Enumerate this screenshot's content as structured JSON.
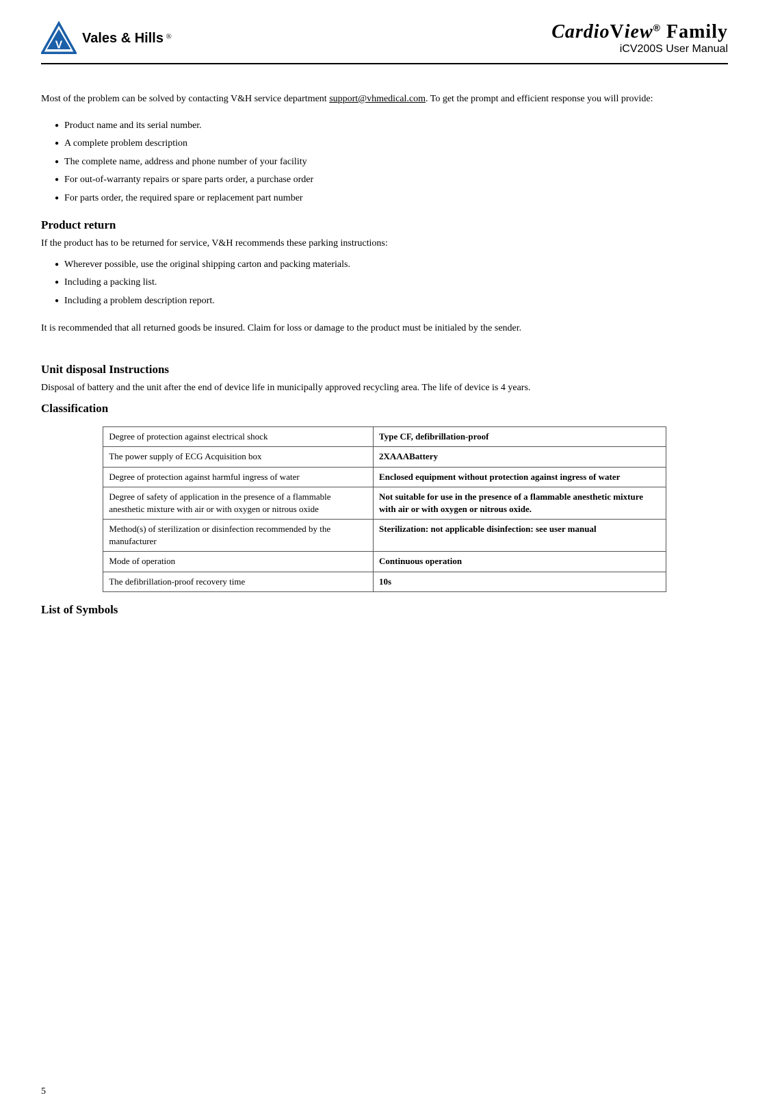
{
  "header": {
    "logo_company": "Vales & Hills",
    "logo_reg": "®",
    "product_name": "CardioView",
    "product_reg": "®",
    "product_family": "Family",
    "product_model": "iCV200S User Manual"
  },
  "intro": {
    "text1": "Most of the problem can be solved by contacting V&H service department ",
    "email": "support@vhmedical.com",
    "text2": ". To get the prompt and efficient response you will provide:"
  },
  "bullet_list_1": [
    "Product name and its serial number.",
    "A complete problem description",
    "The complete name, address and phone number of your facility",
    "For out-of-warranty repairs or spare parts order, a purchase order",
    "For parts order, the required spare or replacement part number"
  ],
  "product_return": {
    "heading": "Product return",
    "text": "If the product has to be returned for service, V&H recommends these parking instructions:"
  },
  "bullet_list_2": [
    "Wherever possible, use the original shipping carton and packing materials.",
    "Including a packing list.",
    "Including a problem description report."
  ],
  "product_return_footer": "It is recommended that all returned goods be insured. Claim for loss or damage to the product must be initialed by the sender.",
  "unit_disposal": {
    "heading": "Unit disposal Instructions",
    "text": "Disposal of battery and the unit after the end of device life in municipally approved recycling area. The life of device is 4 years."
  },
  "classification": {
    "heading": "Classification",
    "table_rows": [
      {
        "col1": "Degree of protection against electrical shock",
        "col2": "Type CF, defibrillation-proof"
      },
      {
        "col1": "The power supply of ECG Acquisition box",
        "col2": "2XAAABattery"
      },
      {
        "col1": "Degree of protection against harmful ingress of water",
        "col2": "Enclosed equipment without protection against ingress of water"
      },
      {
        "col1": "Degree of safety of application in the presence of a flammable anesthetic mixture with air or with oxygen or nitrous oxide",
        "col2": "Not suitable for use in the presence of a flammable anesthetic mixture with air or with oxygen or nitrous oxide."
      },
      {
        "col1": "Method(s) of sterilization or disinfection recommended by the manufacturer",
        "col2": "Sterilization: not applicable disinfection: see user manual"
      },
      {
        "col1": "Mode of operation",
        "col2": "Continuous operation"
      },
      {
        "col1": "The defibrillation-proof recovery time",
        "col2": "10s"
      }
    ]
  },
  "list_of_symbols": {
    "heading": "List of Symbols"
  },
  "page_number": "5"
}
